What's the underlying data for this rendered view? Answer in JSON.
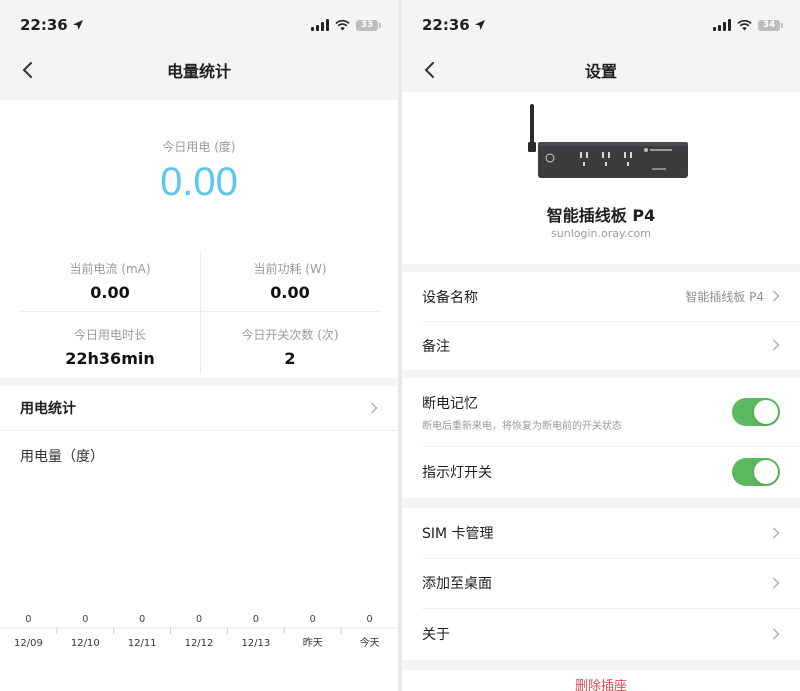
{
  "left": {
    "status": {
      "time": "22:36",
      "battery": "33"
    },
    "nav": {
      "title": "电量统计"
    },
    "summary": {
      "today_label": "今日用电 (度)",
      "today_value": "0.00",
      "stats": [
        {
          "label": "当前电流 (mA)",
          "value": "0.00"
        },
        {
          "label": "当前功耗 (W)",
          "value": "0.00"
        },
        {
          "label": "今日用电时长",
          "value": "22h36min"
        },
        {
          "label": "今日开关次数 (次)",
          "value": "2"
        }
      ]
    },
    "usage": {
      "title": "用电统计",
      "chart_ylabel": "用电量（度）"
    }
  },
  "right": {
    "status": {
      "time": "22:36",
      "battery": "34"
    },
    "nav": {
      "title": "设置"
    },
    "device": {
      "name": "智能插线板 P4",
      "url": "sunlogin.oray.com"
    },
    "rows": {
      "device_name": {
        "label": "设备名称",
        "value": "智能插线板 P4"
      },
      "remark": {
        "label": "备注"
      },
      "power_memory": {
        "label": "断电记忆",
        "sublabel": "断电后重新来电，将恢复为断电前的开关状态",
        "on": true
      },
      "indicator": {
        "label": "指示灯开关",
        "on": true
      },
      "sim": {
        "label": "SIM 卡管理"
      },
      "add_desktop": {
        "label": "添加至桌面"
      },
      "about": {
        "label": "关于"
      }
    },
    "delete_label": "删除插座"
  },
  "colors": {
    "accent_blue": "#5ec7f0",
    "toggle_green": "#5bb85e",
    "danger_red": "#e24b4b"
  },
  "chart_data": {
    "type": "bar",
    "categories": [
      "12/09",
      "12/10",
      "12/11",
      "12/12",
      "12/13",
      "昨天",
      "今天"
    ],
    "values": [
      0,
      0,
      0,
      0,
      0,
      0,
      0
    ],
    "ylabel": "用电量（度）"
  }
}
